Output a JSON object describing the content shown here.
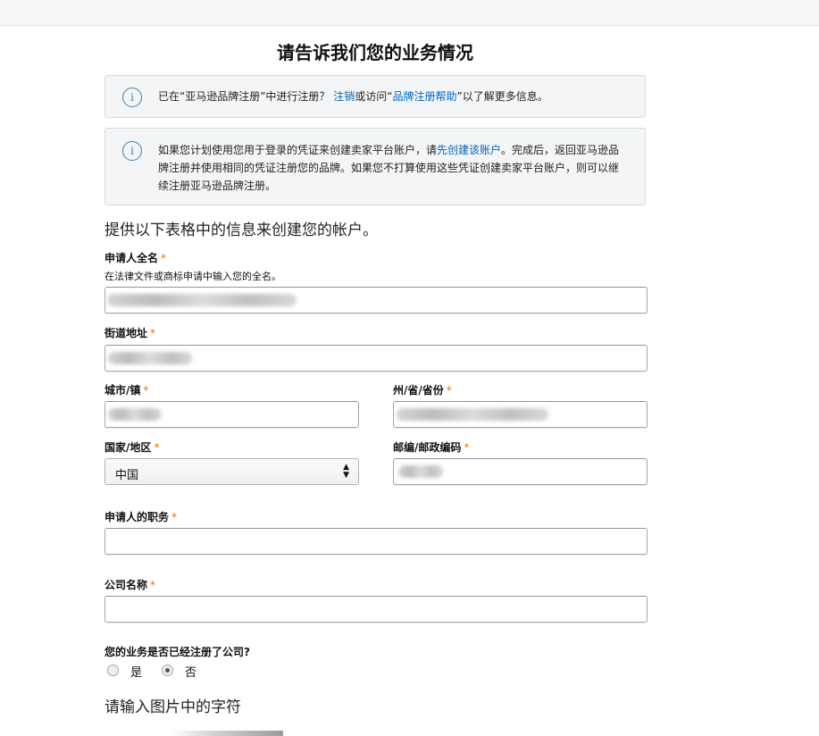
{
  "page": {
    "title": "请告诉我们您的业务情况"
  },
  "alerts": {
    "first": {
      "icon": "info-icon",
      "text_before": "已在“亚马逊品牌注册”中进行注册？ ",
      "link_signin": "注销",
      "text_middle": "或访问“",
      "link_help": "品牌注册帮助",
      "text_after": "”以了解更多信息。"
    },
    "second": {
      "icon": "info-icon",
      "text_before": "如果您计划使用您用于登录的凭证来创建卖家平台账户，请",
      "link_create": "先创建该账户",
      "text_after": "。完成后，返回亚马逊品牌注册并使用相同的凭证注册您的品牌。如果您不打算使用这些凭证创建卖家平台账户，则可以继续注册亚马逊品牌注册。"
    }
  },
  "form": {
    "section_heading": "提供以下表格中的信息来创建您的帐户。",
    "required_mark": "*",
    "applicant_name": {
      "label": "申请人全名",
      "hint": "在法律文件或商标申请中输入您的全名。"
    },
    "street_address": {
      "label": "街道地址"
    },
    "city": {
      "label": "城市/镇"
    },
    "state": {
      "label": "州/省/省份"
    },
    "country": {
      "label": "国家/地区",
      "value": "中国",
      "arrows": "▲▼"
    },
    "postal_code": {
      "label": "邮编/邮政编码"
    },
    "job_title": {
      "label": "申请人的职务"
    },
    "company_name": {
      "label": "公司名称"
    },
    "registered_company": {
      "question": "您的业务是否已经注册了公司?",
      "options": [
        {
          "label": "是",
          "checked": false
        },
        {
          "label": "否",
          "checked": true
        }
      ]
    },
    "captcha_heading": "请输入图片中的字符"
  }
}
